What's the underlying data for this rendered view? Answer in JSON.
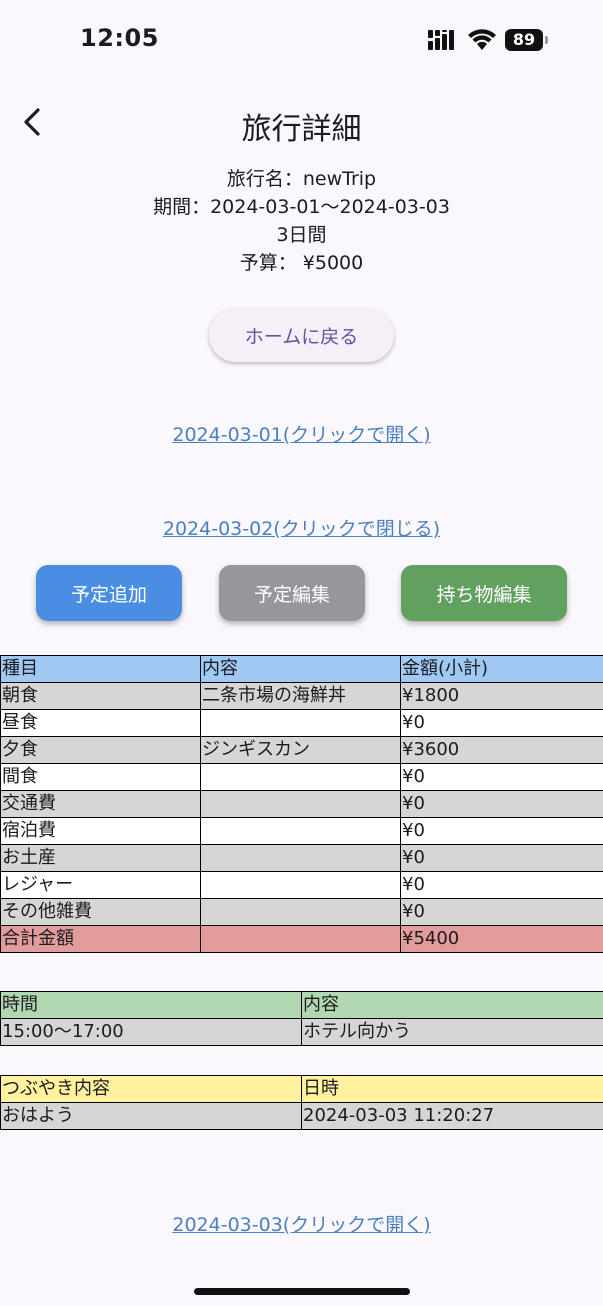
{
  "status_bar": {
    "time": "12:05",
    "battery": "89"
  },
  "header": {
    "title": "旅行詳細"
  },
  "trip": {
    "name_line": "旅行名：newTrip",
    "period_line": "期間：2024-03-01～2024-03-03",
    "days_line": "3日間",
    "budget_line": "予算： ¥5000"
  },
  "home_button": "ホームに戻る",
  "days": [
    {
      "label": "2024-03-01(クリックで開く)"
    },
    {
      "label": "2024-03-02(クリックで閉じる)"
    },
    {
      "label": "2024-03-03(クリックで開く)"
    }
  ],
  "actions": {
    "add_plan": "予定追加",
    "edit_plan": "予定編集",
    "edit_items": "持ち物編集"
  },
  "colors": {
    "add_plan": "#4a8ee4",
    "edit_plan": "#96969c",
    "edit_items": "#62a060",
    "link": "#4a7fc1",
    "expense_header": "#9fc8f3",
    "schedule_header": "#b2d8b2",
    "tweet_header": "#fff19d",
    "total_row": "#e39c9c"
  },
  "expenses": {
    "headers": [
      "種目",
      "内容",
      "金額(小計)"
    ],
    "rows": [
      [
        "朝食",
        "二条市場の海鮮丼",
        "¥1800"
      ],
      [
        "昼食",
        "",
        "¥0"
      ],
      [
        "夕食",
        "ジンギスカン",
        "¥3600"
      ],
      [
        "間食",
        "",
        "¥0"
      ],
      [
        "交通費",
        "",
        "¥0"
      ],
      [
        "宿泊費",
        "",
        "¥0"
      ],
      [
        "お土産",
        "",
        "¥0"
      ],
      [
        "レジャー",
        "",
        "¥0"
      ],
      [
        "その他雑費",
        "",
        "¥0"
      ]
    ],
    "total": [
      "合計金額",
      "",
      "¥5400"
    ]
  },
  "schedule": {
    "headers": [
      "時間",
      "内容"
    ],
    "rows": [
      [
        "15:00～17:00",
        "ホテル向かう"
      ]
    ]
  },
  "tweets": {
    "headers": [
      "つぶやき内容",
      "日時"
    ],
    "rows": [
      [
        "おはよう",
        "2024-03-03 11:20:27"
      ]
    ]
  }
}
